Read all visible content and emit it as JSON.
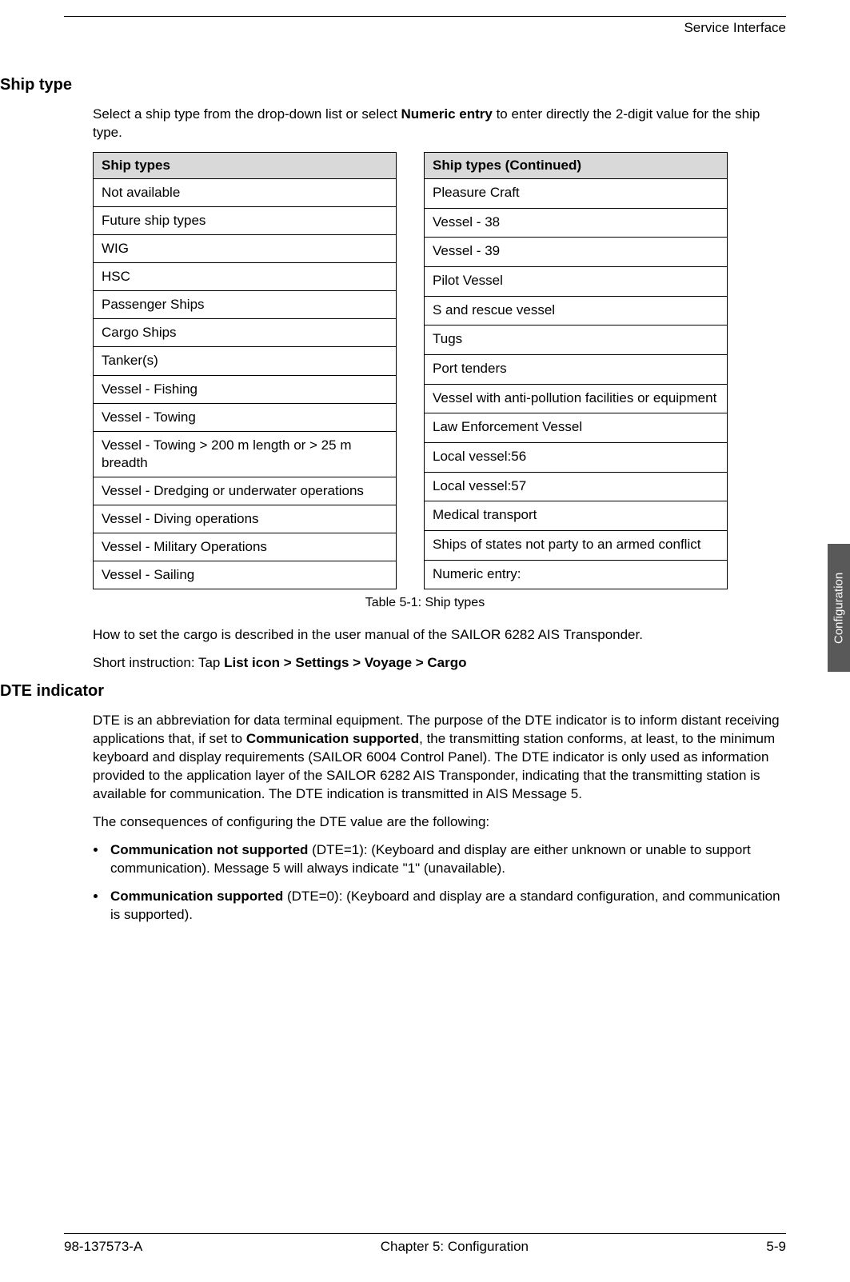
{
  "header": {
    "right": "Service Interface"
  },
  "sideTab": "Configuration",
  "shipType": {
    "heading": "Ship type",
    "intro_pre": "Select a ship type from the drop-down list or select ",
    "intro_bold": "Numeric entry",
    "intro_post": " to enter directly the 2-digit value for the ship type.",
    "leftHeader": "Ship types",
    "rightHeader": "Ship types (Continued)",
    "leftRows": [
      "Not available",
      "Future ship types",
      "WIG",
      "HSC",
      "Passenger Ships",
      "Cargo Ships",
      "Tanker(s)",
      "Vessel - Fishing",
      "Vessel - Towing",
      "Vessel - Towing > 200 m length or > 25 m breadth",
      "Vessel - Dredging or underwater operations",
      "Vessel - Diving operations",
      "Vessel - Military Operations",
      "Vessel - Sailing"
    ],
    "rightRows": [
      "Pleasure Craft",
      "Vessel - 38",
      "Vessel - 39",
      "Pilot Vessel",
      "S and rescue vessel",
      "Tugs",
      "Port tenders",
      "Vessel with anti-pollution facilities or equipment",
      "Law Enforcement Vessel",
      "Local vessel:56",
      "Local vessel:57",
      "Medical transport",
      "Ships of states not party to an armed conflict",
      "Numeric entry:"
    ],
    "caption": "Table 5-1: Ship types",
    "afterTable": "How to set the cargo is described in the user manual of the SAILOR 6282 AIS Transponder.",
    "shortInstr_pre": "Short instruction: Tap ",
    "shortInstr_bold": "List icon > Settings > Voyage > Cargo"
  },
  "dte": {
    "heading": "DTE indicator",
    "p1_a": "DTE is an abbreviation for data terminal equipment. The purpose of the DTE indicator is to inform distant receiving applications that, if set to ",
    "p1_bold": "Communication supported",
    "p1_b": ", the transmitting station conforms, at least, to the minimum keyboard and display requirements (SAILOR 6004 Control Panel). The DTE indicator is only used as information provided to the application layer of the SAILOR 6282 AIS Transponder, indicating that the transmitting station is available for communication. The DTE indication is transmitted in AIS Message 5.",
    "p2": "The consequences of configuring the DTE value are the following:",
    "bullet1_bold": "Communication not supported",
    "bullet1_rest": " (DTE=1): (Keyboard and display are either unknown or unable to support communication). Message 5 will always indicate \"1\" (unavailable).",
    "bullet2_bold": "Communication supported",
    "bullet2_rest": " (DTE=0): (Keyboard and display are a standard configuration, and communication is supported)."
  },
  "footer": {
    "left": "98-137573-A",
    "center": "Chapter 5:  Configuration",
    "right": "5-9"
  }
}
